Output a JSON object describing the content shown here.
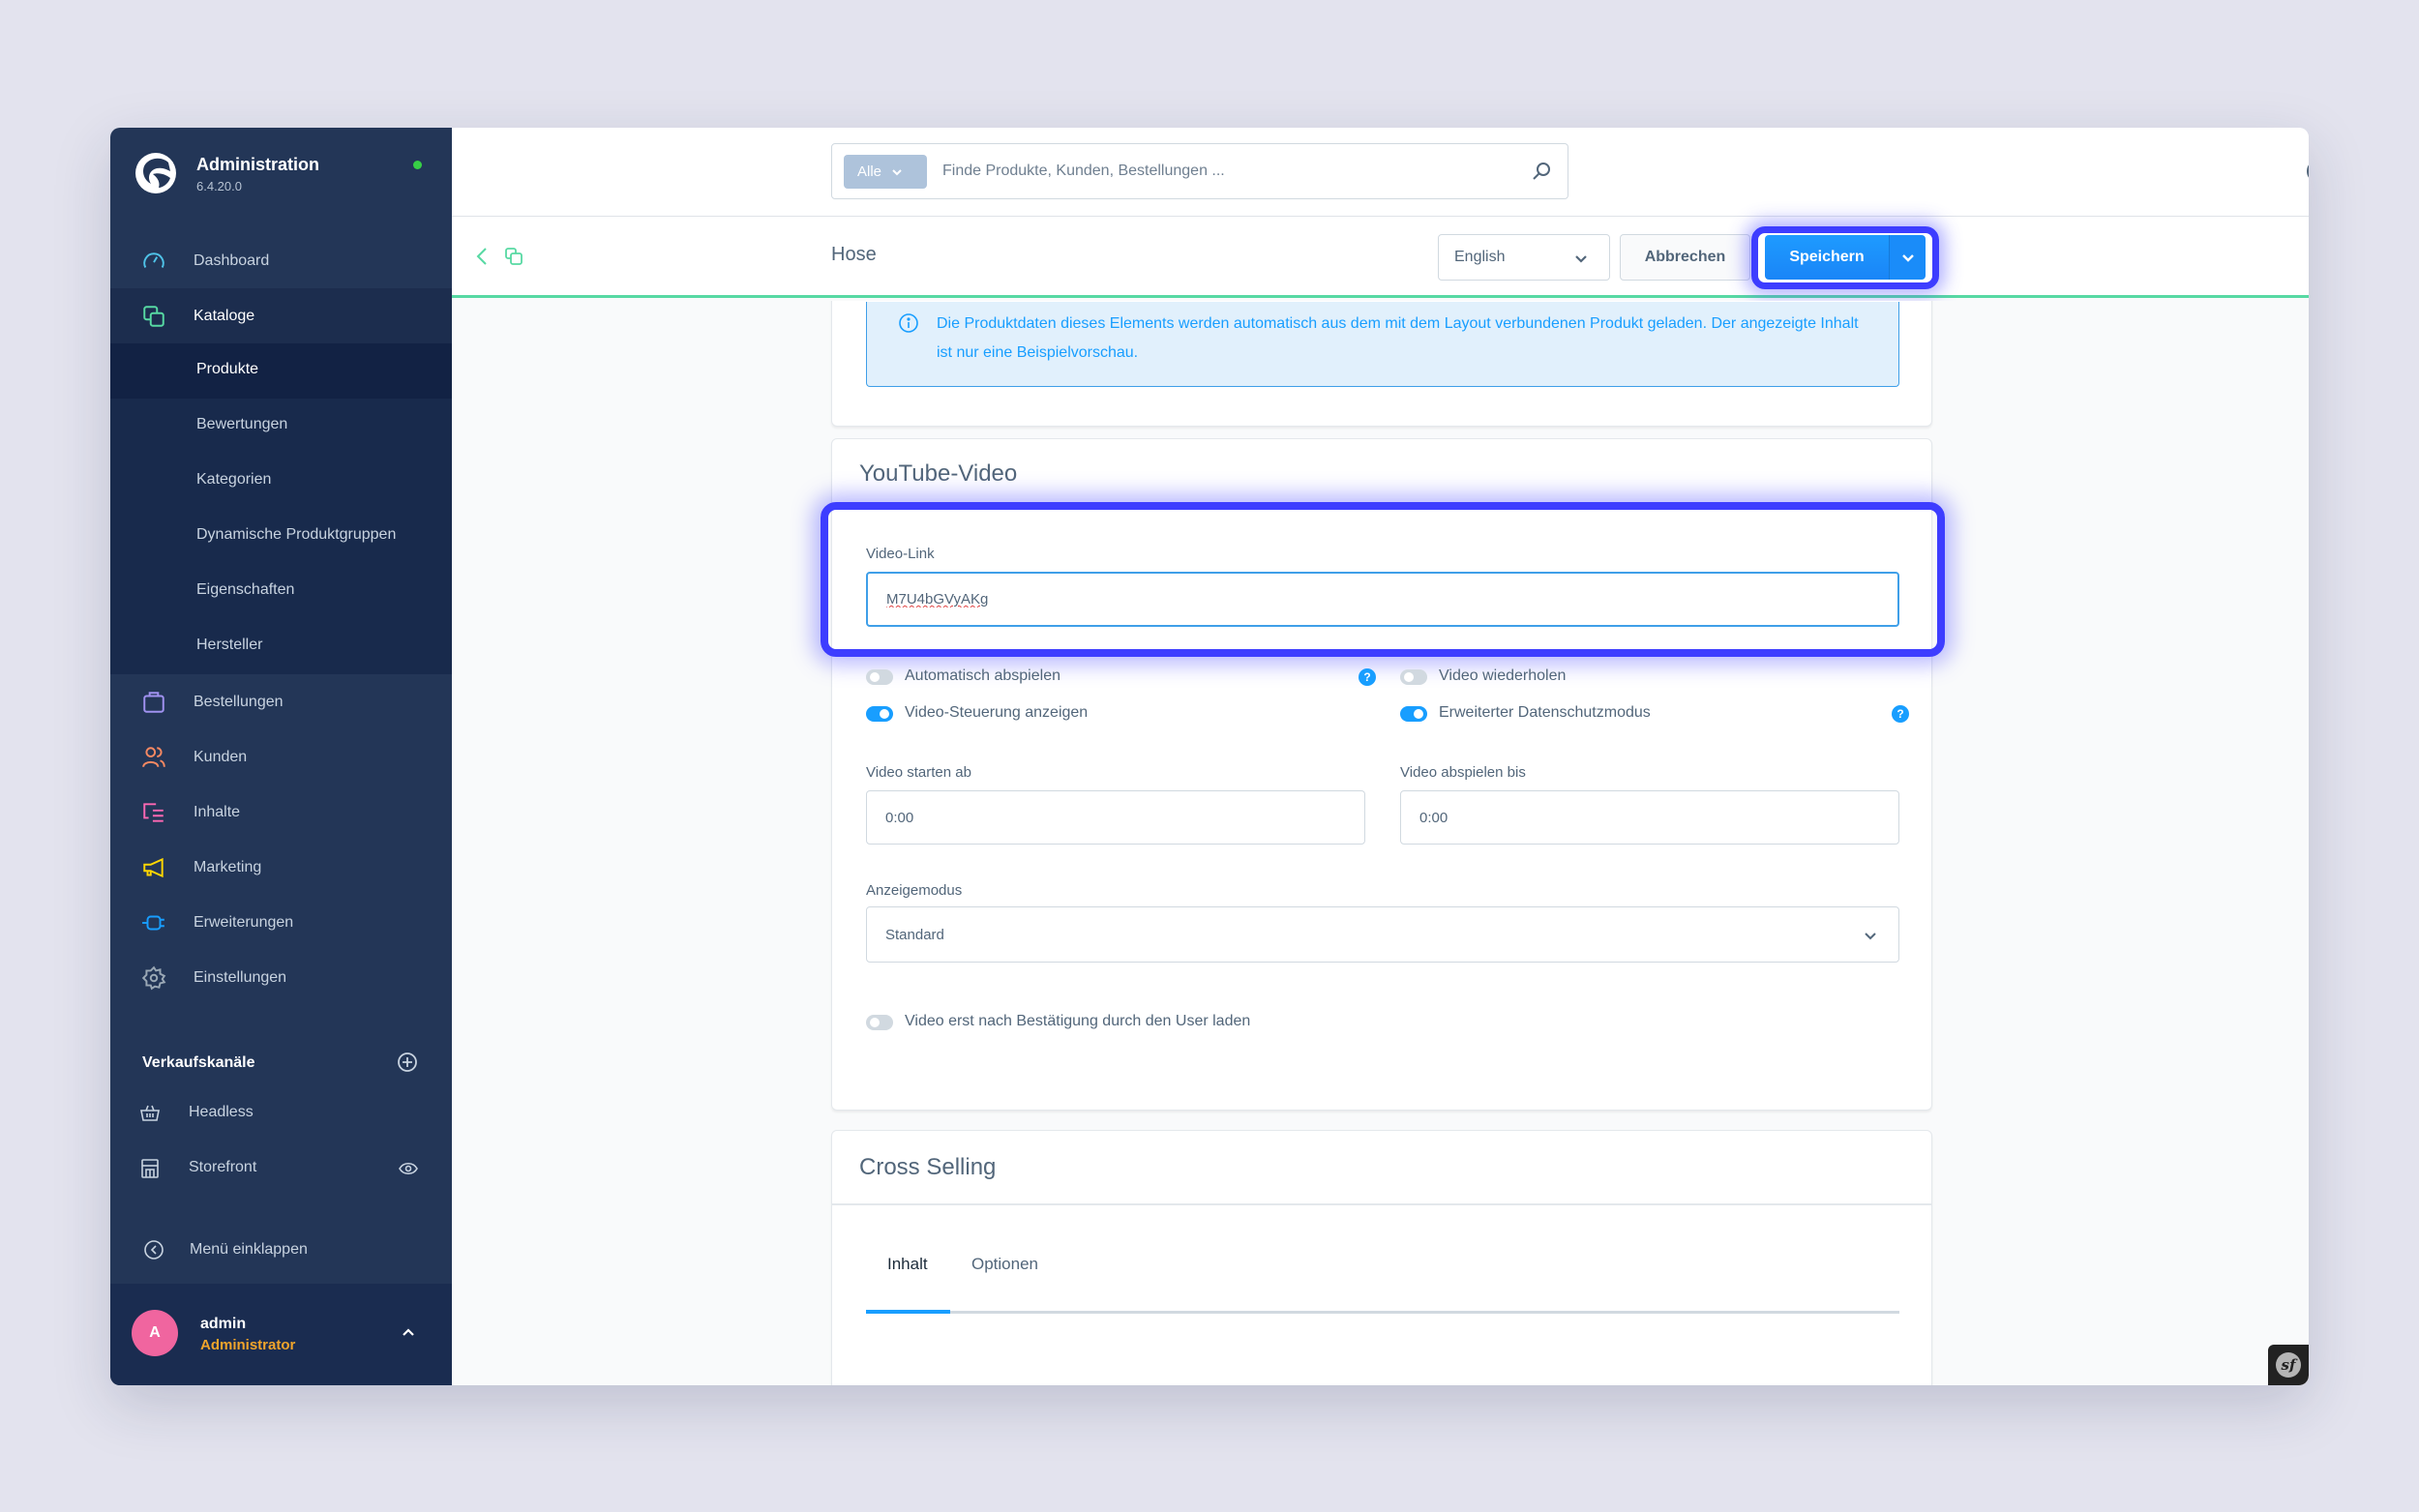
{
  "app": {
    "title": "Administration",
    "version": "6.4.20.0",
    "status_color": "#37d046"
  },
  "sidebar": {
    "items": [
      {
        "label": "Dashboard",
        "icon": "dashboard-icon",
        "color": "#4fc3e8"
      },
      {
        "label": "Kataloge",
        "icon": "catalog-icon",
        "color": "#57d9a3"
      },
      {
        "label": "Bestellungen",
        "icon": "shopping-bag-icon",
        "color": "#a092f0"
      },
      {
        "label": "Kunden",
        "icon": "users-icon",
        "color": "#f88962"
      },
      {
        "label": "Inhalte",
        "icon": "content-icon",
        "color": "#ff68b4"
      },
      {
        "label": "Marketing",
        "icon": "megaphone-icon",
        "color": "#ffd700"
      },
      {
        "label": "Erweiterungen",
        "icon": "plug-icon",
        "color": "#189eff"
      },
      {
        "label": "Einstellungen",
        "icon": "gear-icon",
        "color": "#9aa8b5"
      }
    ],
    "catalog_sub": [
      "Produkte",
      "Bewertungen",
      "Kategorien",
      "Dynamische Produktgruppen",
      "Eigenschaften",
      "Hersteller"
    ],
    "active_sub": "Produkte",
    "sales_channels_title": "Verkaufskanäle",
    "sales_channels": [
      {
        "label": "Headless",
        "icon": "basket-icon"
      },
      {
        "label": "Storefront",
        "icon": "storefront-icon"
      }
    ],
    "collapse_label": "Menü einklappen",
    "user": {
      "initial": "A",
      "name": "admin",
      "role": "Administrator"
    }
  },
  "topbar": {
    "search_type": "Alle",
    "search_placeholder": "Finde Produkte, Kunden, Bestellungen ..."
  },
  "smartbar": {
    "title": "Hose",
    "language": "English",
    "cancel_label": "Abbrechen",
    "save_label": "Speichern"
  },
  "info_alert": "Die Produktdaten dieses Elements werden automatisch aus dem mit dem Layout verbundenen Produkt geladen. Der angezeigte Inhalt ist nur eine Beispielvorschau.",
  "youtube": {
    "title": "YouTube-Video",
    "video_link_label": "Video-Link",
    "video_link_value": "M7U4bGVyAKg",
    "switches": [
      {
        "label": "Automatisch abspielen",
        "on": false,
        "help": true
      },
      {
        "label": "Video wiederholen",
        "on": false,
        "help": false
      },
      {
        "label": "Video-Steuerung anzeigen",
        "on": true,
        "help": false
      },
      {
        "label": "Erweiterter Datenschutzmodus",
        "on": true,
        "help": true
      }
    ],
    "start_label": "Video starten ab",
    "start_value": "0:00",
    "end_label": "Video abspielen bis",
    "end_value": "0:00",
    "display_mode_label": "Anzeigemodus",
    "display_mode_value": "Standard",
    "confirm_switch": {
      "label": "Video erst nach Bestätigung durch den User laden",
      "on": false
    }
  },
  "cross_selling": {
    "title": "Cross Selling",
    "tabs": [
      "Inhalt",
      "Optionen"
    ],
    "active_tab": "Inhalt"
  },
  "help_glyph": "?",
  "symfony_glyph": "sf"
}
